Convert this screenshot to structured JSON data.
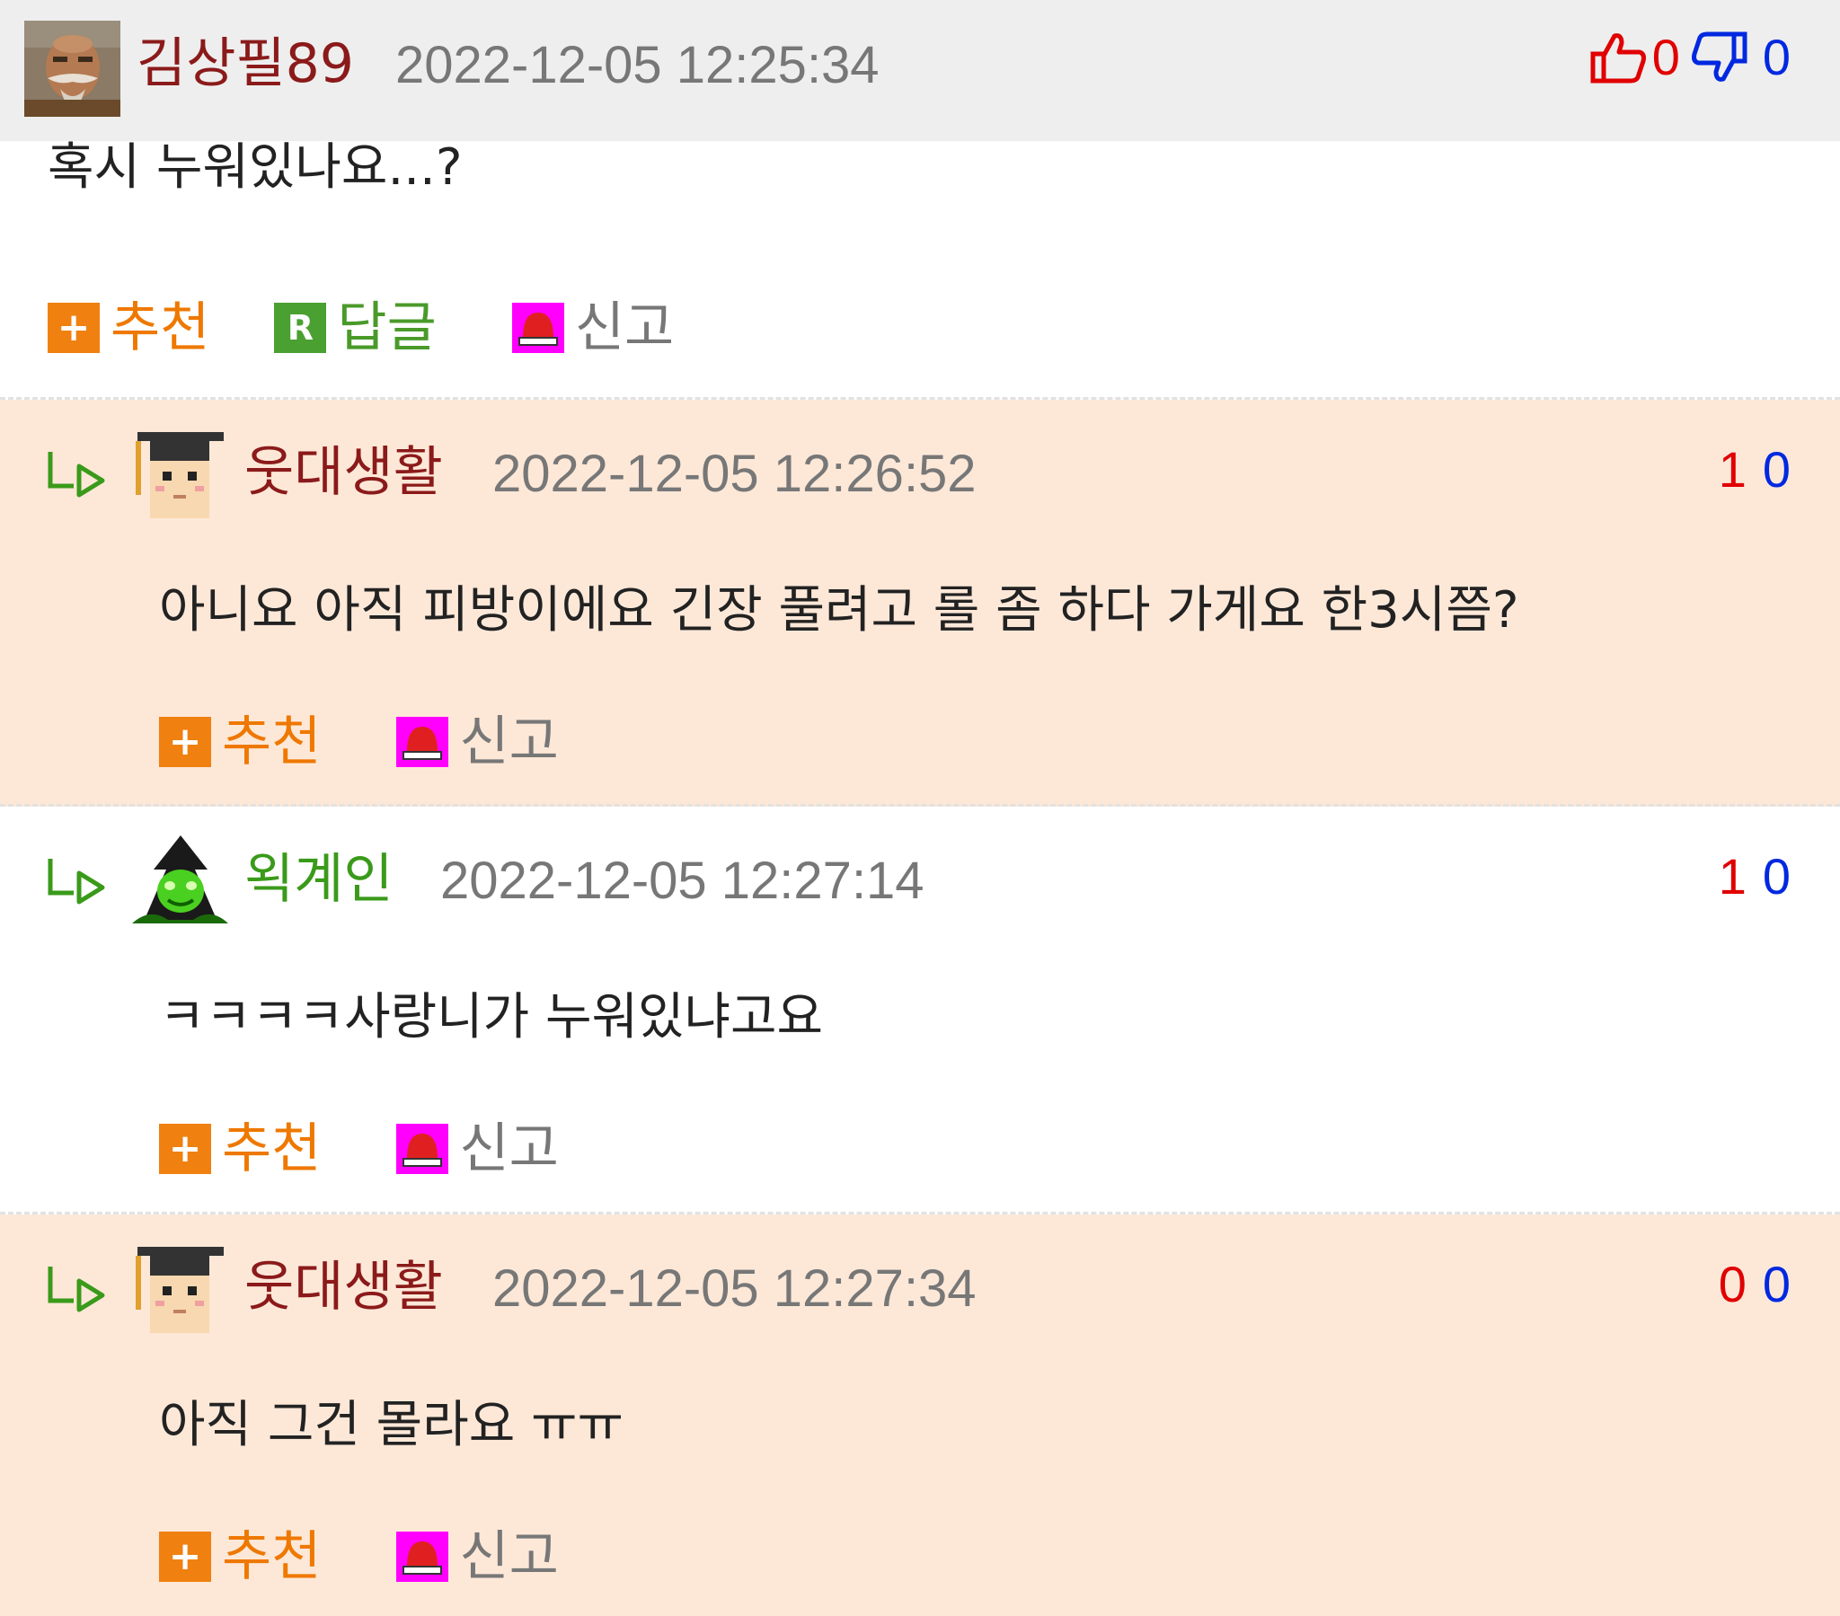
{
  "parent_comment": {
    "author": "김상필89",
    "author_color": "#8b1a1a",
    "timestamp": "2022-12-05 12:25:34",
    "upvotes": "0",
    "downvotes": "0",
    "content": "혹시 누워있나요...?",
    "actions": {
      "recommend_label": "추천",
      "reply_label": "답글",
      "report_label": "신고"
    }
  },
  "replies": [
    {
      "author": "웃대생활",
      "author_color": "#8b1a1a",
      "timestamp": "2022-12-05 12:26:52",
      "upvotes": "1",
      "downvotes": "0",
      "content": "아니요 아직 피방이에요 긴장 풀려고 롤 좀 하다 가게요 한3시쯤?",
      "recommend_label": "추천",
      "report_label": "신고",
      "background": "#fde8d8"
    },
    {
      "author": "왹계인",
      "author_color": "#3a9a1a",
      "timestamp": "2022-12-05 12:27:14",
      "upvotes": "1",
      "downvotes": "0",
      "content": "ㅋㅋㅋㅋ사랑니가 누워있냐고요",
      "recommend_label": "추천",
      "report_label": "신고",
      "background": "#ffffff"
    },
    {
      "author": "웃대생활",
      "author_color": "#8b1a1a",
      "timestamp": "2022-12-05 12:27:34",
      "upvotes": "0",
      "downvotes": "0",
      "content": "아직 그건 몰라요 ㅠㅠ",
      "recommend_label": "추천",
      "report_label": "신고",
      "background": "#fde8d8"
    }
  ],
  "icons": {
    "recommend": "plus-icon",
    "reply": "reply-r-icon",
    "report": "siren-icon",
    "upvote": "thumbs-up-icon",
    "downvote": "thumbs-down-icon",
    "reply_indicator": "reply-arrow-icon"
  },
  "colors": {
    "upvote": "#e00000",
    "downvote": "#0028e0",
    "recommend": "#ee7800",
    "reply": "#4a9a2a",
    "report": "#777777",
    "timestamp": "#777777"
  }
}
